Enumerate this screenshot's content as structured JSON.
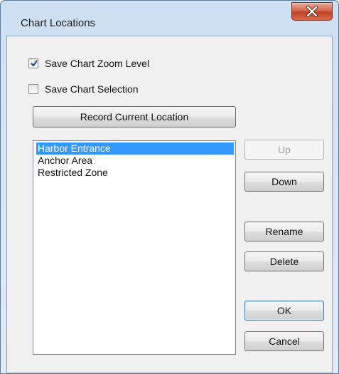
{
  "window": {
    "title": "Chart Locations"
  },
  "options": {
    "save_zoom_label": "Save Chart Zoom Level",
    "save_zoom_checked": true,
    "save_selection_label": "Save Chart Selection",
    "save_selection_checked": false
  },
  "buttons": {
    "record_label": "Record Current Location",
    "up_label": "Up",
    "down_label": "Down",
    "rename_label": "Rename",
    "delete_label": "Delete",
    "ok_label": "OK",
    "cancel_label": "Cancel"
  },
  "locations": {
    "items": [
      "Harbor Entrance",
      "Anchor Area",
      "Restricted Zone"
    ],
    "selected_index": 0
  },
  "colors": {
    "selection": "#3399ff",
    "close_button": "#c24227"
  },
  "icons": {
    "close": "close-icon",
    "checkmark": "checkmark-icon"
  }
}
